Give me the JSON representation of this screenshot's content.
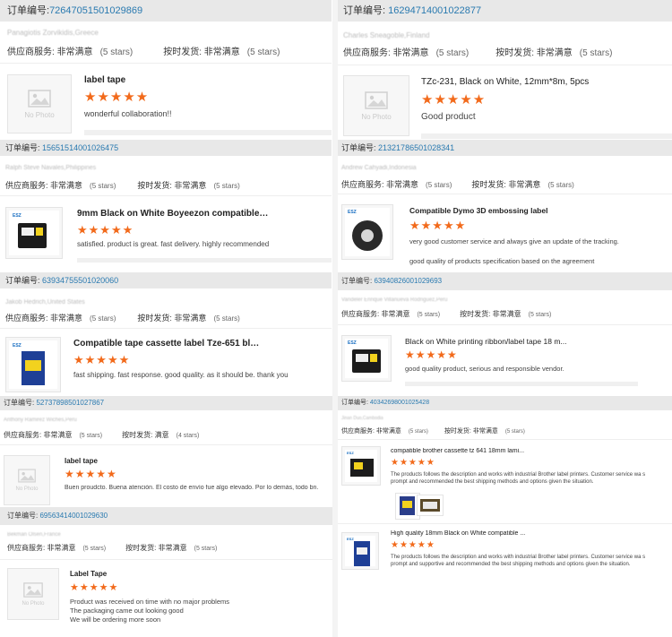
{
  "labels": {
    "order_prefix": "订单编号:",
    "supplier_service": "供应商服务:",
    "shipping_speed": "按时发货:",
    "very_satisfied": "非常满意",
    "satisfied": "满意",
    "no_photo": "No Photo"
  },
  "left": [
    {
      "order": "72647051501029869",
      "buyer": "Panagiotis Zorvikidis,Greece",
      "supplier_stars": "(5 stars)",
      "shipping_value": "非常满意",
      "shipping_stars": "(5 stars)",
      "title": "label tape",
      "stars": "★★★★★",
      "review": "wonderful collaboration!!"
    },
    {
      "order": "15651514001026475",
      "buyer": "Ralph Steve Navales,Philippines",
      "supplier_stars": "(5 stars)",
      "shipping_value": "非常满意",
      "shipping_stars": "(5 stars)",
      "title": "9mm Black on White Boyeezon compatible Bro...",
      "stars": "★★★★★",
      "review": "satisfied. product is great. fast delivery. highly recommended"
    },
    {
      "order": "63934755501020060",
      "buyer": "Jakob Hedrich,United States",
      "supplier_stars": "(5 stars)",
      "shipping_value": "非常满意",
      "shipping_stars": "(5 stars)",
      "title": "Compatible tape cassette label Tze-651 black ...",
      "stars": "★★★★★",
      "review": "fast shipping. fast response. good quality. as it should be. thank you"
    },
    {
      "order": "52737898501027867",
      "buyer": "Anthony Ramirez Wiches,Peru",
      "supplier_stars": "(5 stars)",
      "shipping_value": "满意",
      "shipping_stars": "(4 stars)",
      "title": "label tape",
      "stars": "★★★★★",
      "review": "Buen proudcto. Buena atención. El costo de envío fue algo elevado. Por lo demás, todo bn."
    },
    {
      "order": "69563414001029630",
      "buyer": "Bekman Olsen,France",
      "supplier_stars": "(5 stars)",
      "shipping_value": "非常满意",
      "shipping_stars": "(5 stars)",
      "title": "Label Tape",
      "stars": "★★★★★",
      "review_lines": [
        "Product was received on time with no major problems",
        "The packaging came out looking good",
        "We will be ordering more soon"
      ]
    }
  ],
  "right": [
    {
      "order": "16294714001022877",
      "buyer": "Charles Sneagoble,Finland",
      "supplier_stars": "(5 stars)",
      "shipping_value": "非常满意",
      "shipping_stars": "(5 stars)",
      "title": "TZc-231, Black on White, 12mm*8m, 5pcs",
      "stars": "★★★★★",
      "review": "Good product"
    },
    {
      "order": "21321786501028341",
      "buyer": "Andrew Cahyadi,Indonesia",
      "supplier_stars": "(5 stars)",
      "shipping_value": "非常满意",
      "shipping_stars": "(5 stars)",
      "title": "Compatible Dymo 3D embossing label",
      "stars": "★★★★★",
      "review_lines": [
        "very good customer service and always give an update of the tracking.",
        "good quality of products specification based on the agreement"
      ]
    },
    {
      "order": "63940826001029693",
      "buyer": "Vandeler Enrique Villanueva Rodriguez,Peru",
      "supplier_stars": "(5 stars)",
      "shipping_value": "非常满意",
      "shipping_stars": "(5 stars)",
      "title": "Black on White printing ribbon/label tape 18 m...",
      "stars": "★★★★★",
      "review": "good quality product, serious and responsible vendor."
    },
    {
      "order": "40342698001025428",
      "buyer": "Jinan Duo,Cambodia",
      "supplier_stars": "(5 stars)",
      "shipping_value": "非常满意",
      "shipping_stars": "(5 stars)",
      "title": "compatible brother cassette tz 641 18mm lami...",
      "stars": "★★★★★",
      "review": "The products follows the description and works with industrial Brother label printers. Customer service wa s prompt and recommended the best shipping methods and options given the situation."
    },
    {
      "title": "High quality 18mm Black on White compatible ...",
      "stars": "★★★★★",
      "review": "The products follows the description and works with industrial Brother label printers. Customer service wa s prompt and supportive and recommended the best shipping methods and options given the situation."
    }
  ]
}
